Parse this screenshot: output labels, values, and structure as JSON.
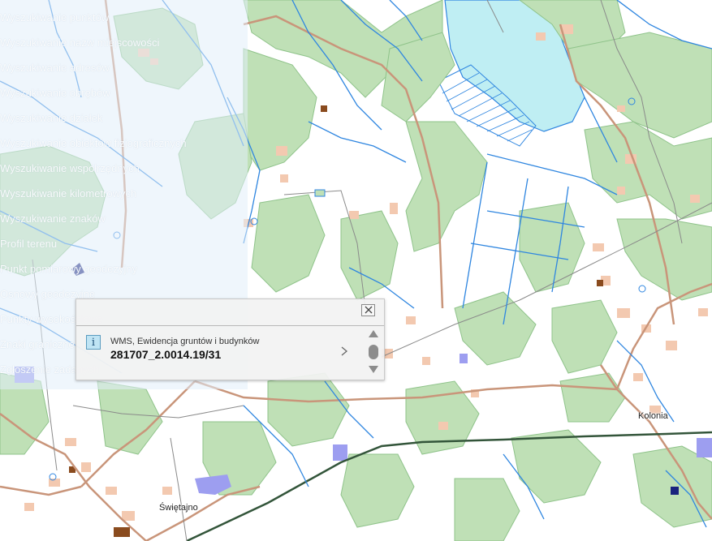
{
  "map": {
    "colors": {
      "forest": "#bfe0b6",
      "forest_edge": "#8fc38a",
      "water": "#bfeef3",
      "stream": "#2f86e0",
      "building": "#f3c9b0",
      "road": "#c9957a",
      "railway": "#33553a",
      "industrial": "#9d9ef0"
    },
    "labels": {
      "kolonia": "Kolonia",
      "swietajno": "Świętajno"
    }
  },
  "menu": {
    "items": [
      "Wyszukiwanie punktów",
      "Wyszukiwanie nazw miejscowości",
      "Wyszukiwanie adresów",
      "Wyszukiwanie obrębów",
      "Wyszukiwanie działek",
      "Wyszukiwanie obiektów fizjograficznych",
      "Wyszukiwanie współrzędnych",
      "Wyszukiwanie kilometrowych",
      "Wyszukiwanie znaków",
      "Profil terenu",
      "Punkt pomiarowy geodezyjny",
      "Osnowy geodezyjne",
      "Punkty wysokościowe",
      "Znaki graniczne",
      "Zgłoszenie zadanych"
    ]
  },
  "popup": {
    "layer": "WMS, Ewidencja gruntów i budynków",
    "feature_id": "281707_2.0014.19/31",
    "info_icon": "i"
  }
}
